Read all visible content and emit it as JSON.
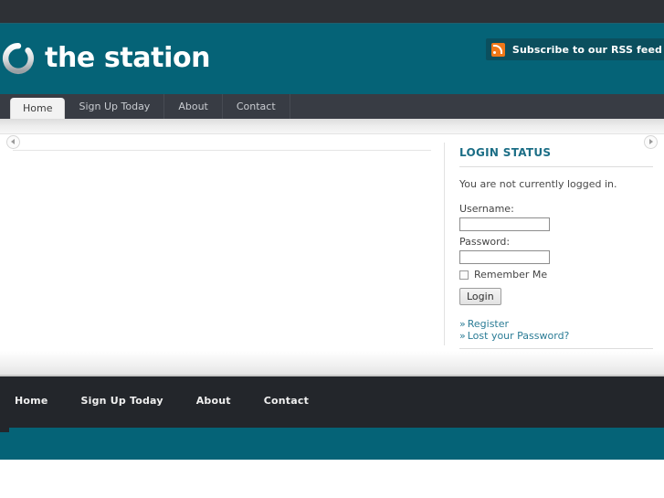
{
  "site": {
    "title": "the station",
    "logo_icon": "ring-logo-icon"
  },
  "header": {
    "rss": {
      "icon": "rss-feed-icon",
      "label": "Subscribe to our RSS feed"
    }
  },
  "nav": {
    "items": [
      {
        "label": "Home",
        "active": true
      },
      {
        "label": "Sign Up Today",
        "active": false
      },
      {
        "label": "About",
        "active": false
      },
      {
        "label": "Contact",
        "active": false
      }
    ]
  },
  "carousel": {
    "prev_icon": "arrow-left-icon",
    "next_icon": "arrow-right-icon"
  },
  "sidebar": {
    "login_widget": {
      "title": "LOGIN STATUS",
      "status_text": "You are not currently logged in.",
      "username_label": "Username:",
      "username_value": "",
      "password_label": "Password:",
      "password_value": "",
      "remember_label": "Remember Me",
      "login_button": "Login",
      "links": [
        {
          "chevron": "»",
          "label": "Register"
        },
        {
          "chevron": "»",
          "label": "Lost your Password?"
        }
      ]
    }
  },
  "footer": {
    "items": [
      {
        "label": "Home"
      },
      {
        "label": "Sign Up Today"
      },
      {
        "label": "About"
      },
      {
        "label": "Contact"
      }
    ]
  },
  "colors": {
    "teal": "#056377",
    "dark_bar": "#2e3136",
    "nav_bar": "#383c44",
    "footer_dark": "#23262b",
    "accent_link": "#2b7c96",
    "widget_title": "#1c6e86",
    "rss_orange": "#f07818"
  }
}
